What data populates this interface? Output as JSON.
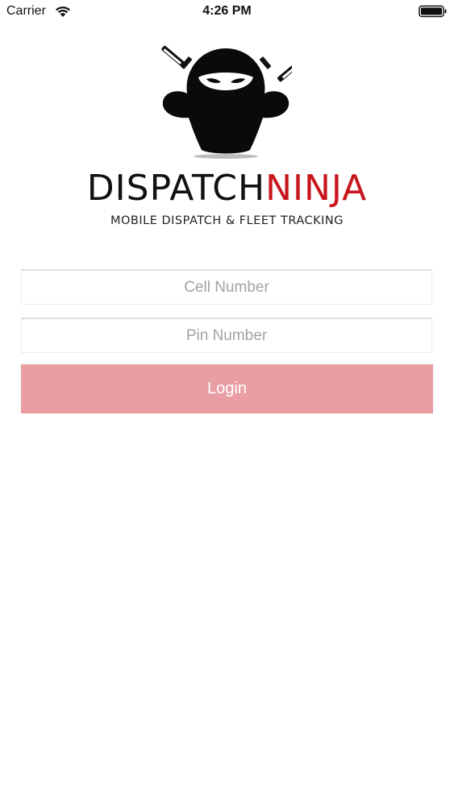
{
  "status_bar": {
    "carrier": "Carrier",
    "time": "4:26 PM",
    "wifi_icon": "wifi-icon",
    "battery_icon": "battery-icon"
  },
  "brand": {
    "name_part1": "DISPATCH",
    "name_part2": "NINJA",
    "tagline": "MOBILE DISPATCH & FLEET TRACKING",
    "accent_color": "#c8151d",
    "mascot_icon": "ninja-mascot-logo"
  },
  "login_form": {
    "cell_placeholder": "Cell Number",
    "cell_value": "",
    "pin_placeholder": "Pin Number",
    "pin_value": "",
    "login_label": "Login",
    "login_color": "#e89ea3"
  }
}
